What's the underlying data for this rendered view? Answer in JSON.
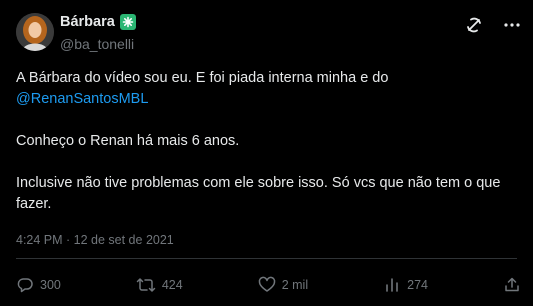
{
  "author": {
    "name": "Bárbara",
    "handle": "@ba_tonelli"
  },
  "tweet": {
    "line1": "A Bárbara do vídeo sou eu. E foi piada interna minha e do",
    "mention": "@RenanSantosMBL",
    "line2": "Conheço o Renan há mais 6 anos.",
    "line3a": "Inclusive não tive problemas com ele sobre isso. Só vcs que não tem o que",
    "line3b": "fazer."
  },
  "meta": {
    "timestamp": "4:24 PM · 12 de set de 2021"
  },
  "actions": {
    "replies": "300",
    "retweets": "424",
    "likes": "2 mil",
    "views": "274"
  },
  "colors": {
    "background": "#000000",
    "text": "#e7e9ea",
    "secondary": "#71767b",
    "link": "#1d9bf0",
    "badge": "#2bb673"
  }
}
